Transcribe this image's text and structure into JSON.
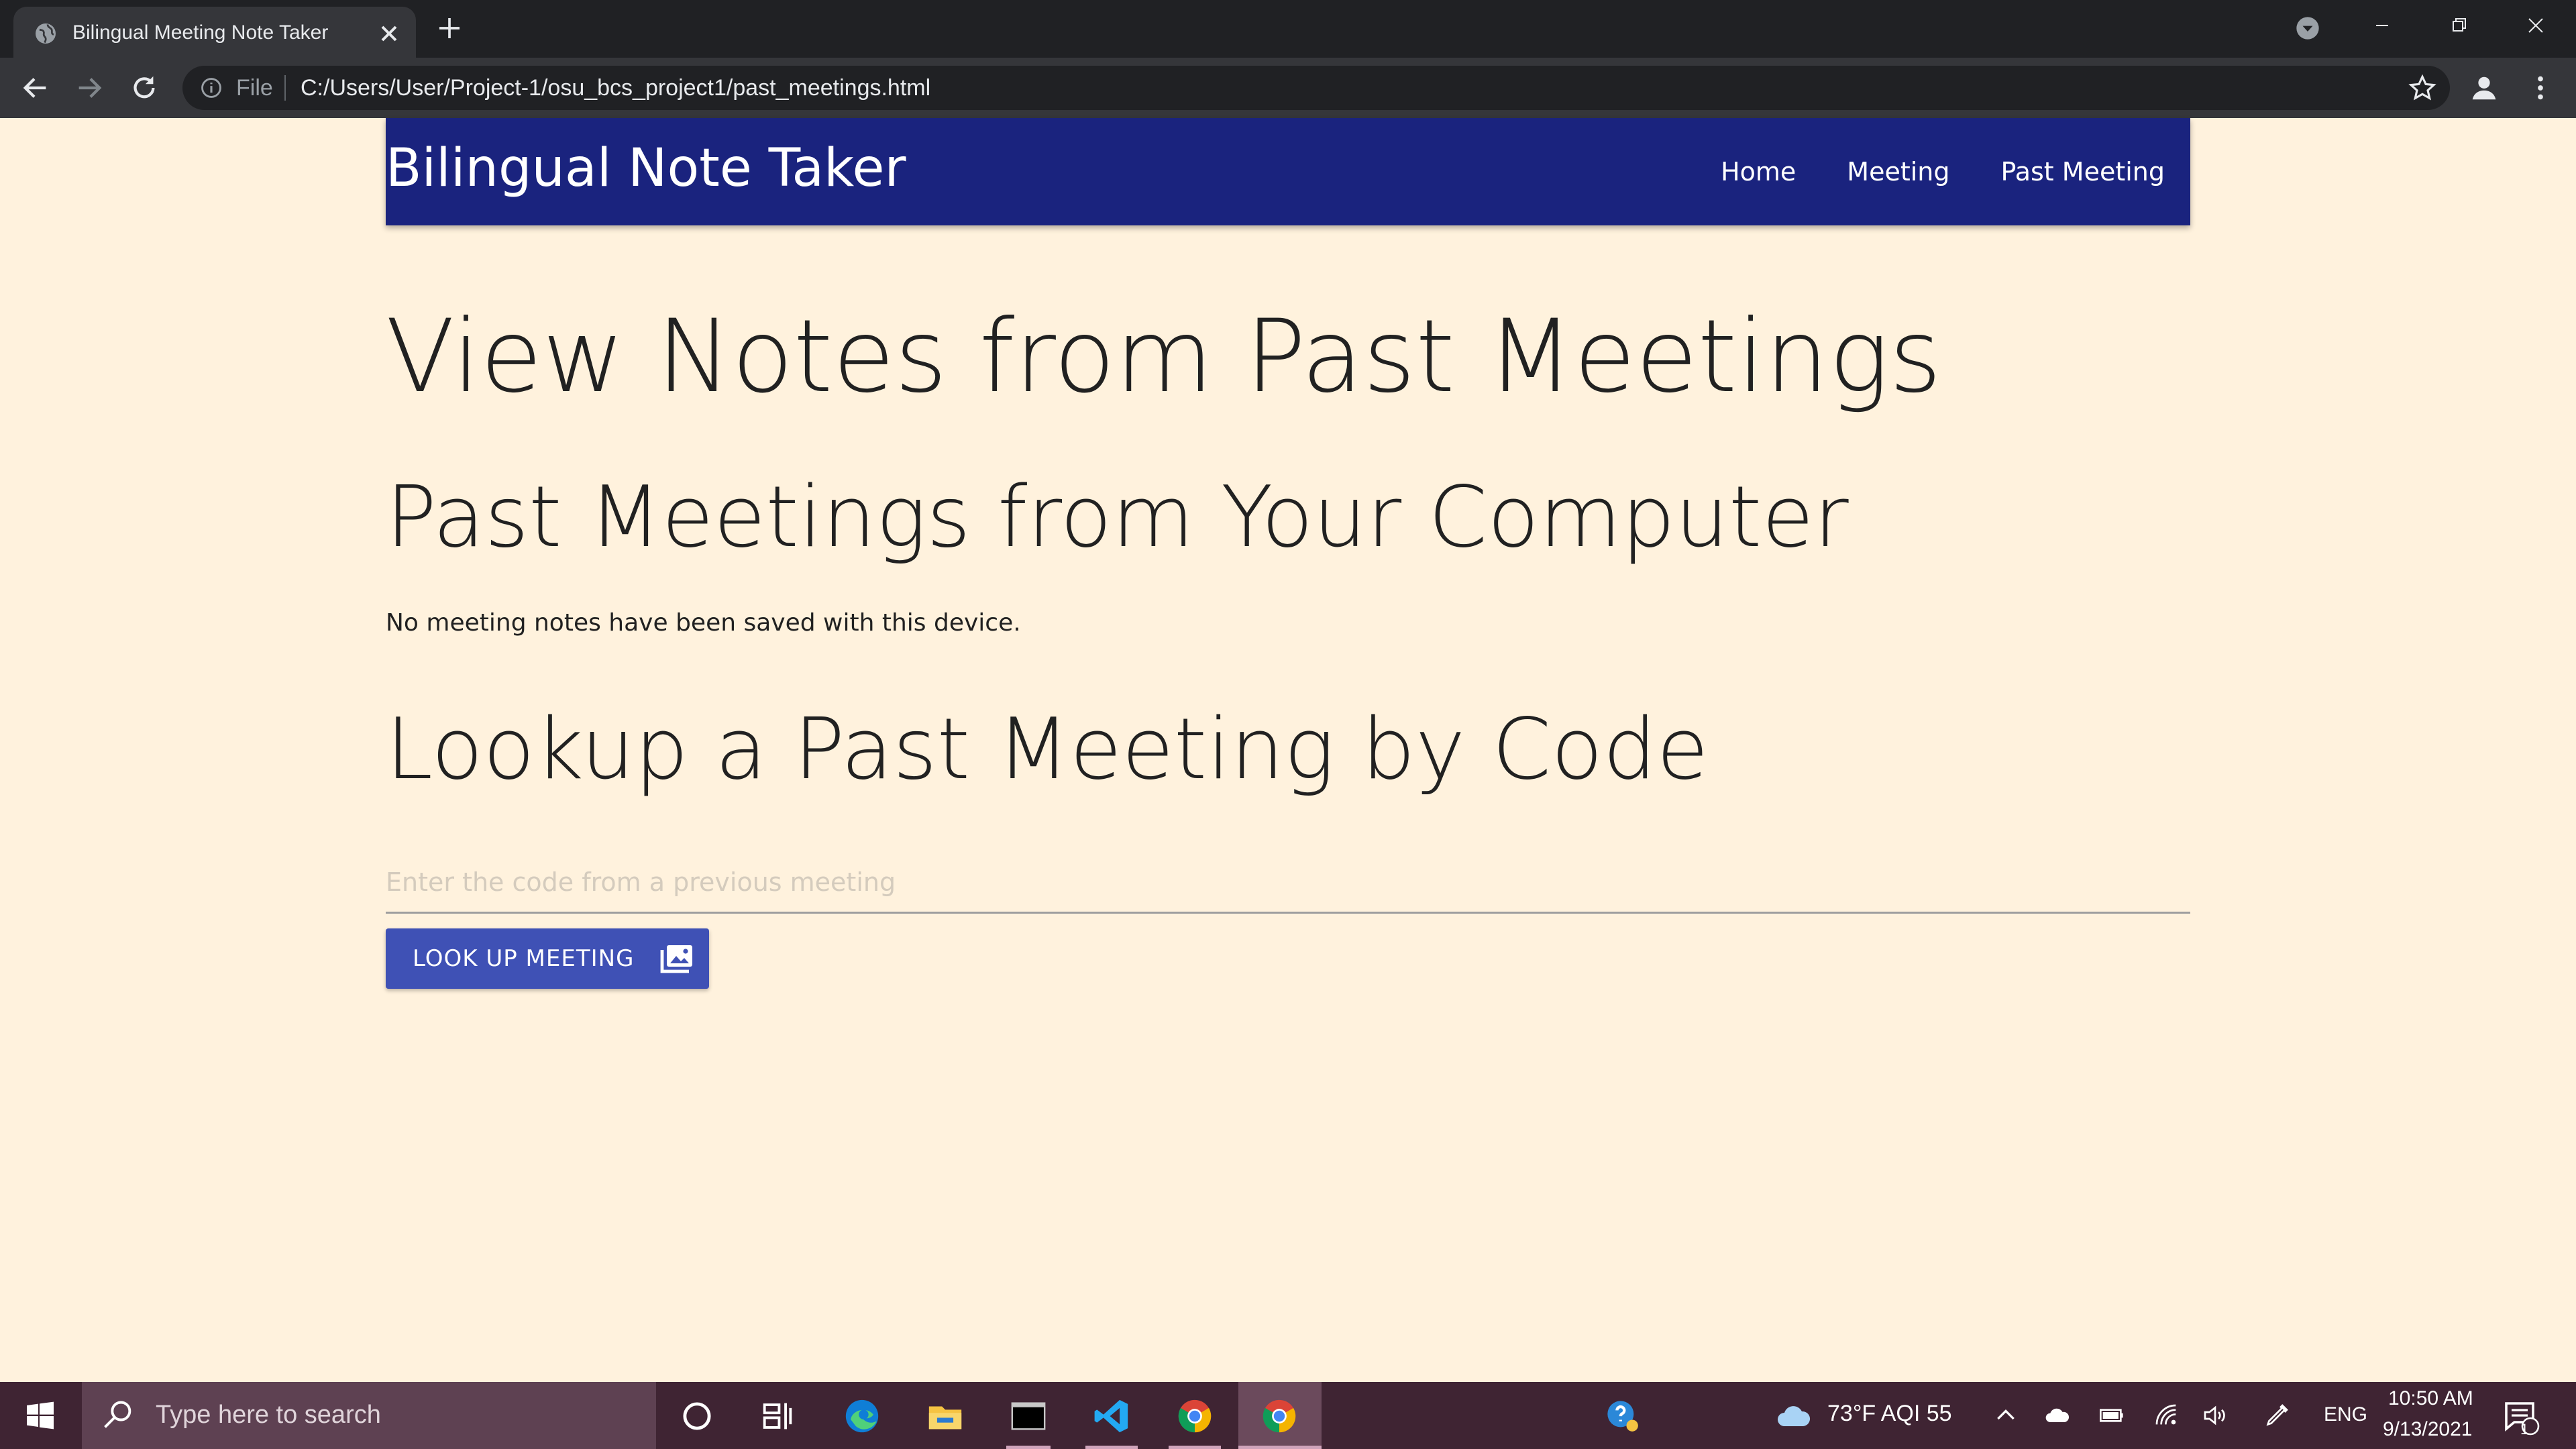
{
  "browser": {
    "tab_title": "Bilingual Meeting Note Taker",
    "url_scheme": "File",
    "url": "C:/Users/User/Project-1/osu_bcs_project1/past_meetings.html"
  },
  "navbar": {
    "brand": "Bilingual Note Taker",
    "links": [
      "Home",
      "Meeting",
      "Past Meeting"
    ],
    "color": "#1a237e"
  },
  "main": {
    "title": "View Notes from Past Meetings",
    "local_heading": "Past Meetings from Your Computer",
    "no_notes_message": "No meeting notes have been saved with this device.",
    "lookup_heading": "Lookup a Past Meeting by Code",
    "code_input_placeholder": "Enter the code from a previous meeting",
    "code_input_value": "",
    "lookup_button_label": "LOOK UP MEETING",
    "lookup_button_color": "#3f51b5",
    "page_background": "#fff2dd"
  },
  "taskbar": {
    "search_placeholder": "Type here to search",
    "pinned_apps": [
      "cortana-icon",
      "task-view-icon",
      "edge-icon",
      "file-explorer-icon",
      "terminal-icon",
      "vscode-icon",
      "chrome-icon",
      "chrome-icon"
    ],
    "weather": "73°F  AQI 55",
    "language": "ENG",
    "time": "10:50 AM",
    "date": "9/13/2021",
    "notification_count": "1"
  }
}
